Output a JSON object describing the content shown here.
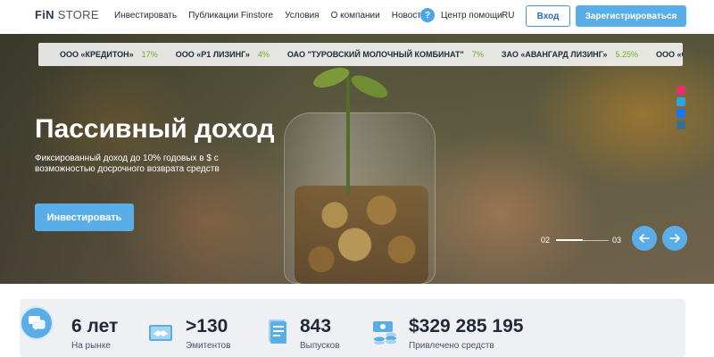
{
  "header": {
    "logo_mark": "FiN",
    "logo_text": "STORE",
    "nav": [
      "Инвестировать",
      "Публикации Finstore",
      "Условия",
      "О компании",
      "Новости"
    ],
    "help_icon": "?",
    "help_label": "Центр помощи",
    "lang": "RU",
    "login_label": "Вход",
    "register_label": "Зарегистрироваться"
  },
  "ticker": [
    {
      "name": "ООО «КРЕДИТОН»",
      "value": "17%"
    },
    {
      "name": "ООО «Р1 ЛИЗИНГ»",
      "value": "4%"
    },
    {
      "name": "ОАО \"ТУРОВСКИЙ МОЛОЧНЫЙ КОМБИНАТ\"",
      "value": "7%"
    },
    {
      "name": "ЗАО «АВАНГАРД ЛИЗИНГ»",
      "value": "5.25%"
    },
    {
      "name": "ООО «СТАТУ",
      "value": ""
    }
  ],
  "hero": {
    "title": "Пассивный доход",
    "subtitle": "Фиксированный доход до 10% годовых в $ с возможностью досрочного возврата средств",
    "invest_label": "Инвестировать",
    "slide_current": "02",
    "slide_total": "03",
    "slide_progress": 0.5
  },
  "social_icons": [
    "instagram-icon",
    "telegram-icon",
    "facebook-icon",
    "odnoklassniki-icon"
  ],
  "stats": [
    {
      "value": "6 лет",
      "label": "На рынке",
      "icon": "chat-bubble-icon"
    },
    {
      "value": ">130",
      "label": "Эмитентов",
      "icon": "handshake-icon"
    },
    {
      "value": "843",
      "label": "Выпусков",
      "icon": "document-icon"
    },
    {
      "value": "$329 285 195",
      "label": "Привлечено средств",
      "icon": "money-icon"
    }
  ],
  "colors": {
    "accent": "#5aaee8",
    "ticker_green": "#6fae2d",
    "text_dark": "#1f2937"
  }
}
